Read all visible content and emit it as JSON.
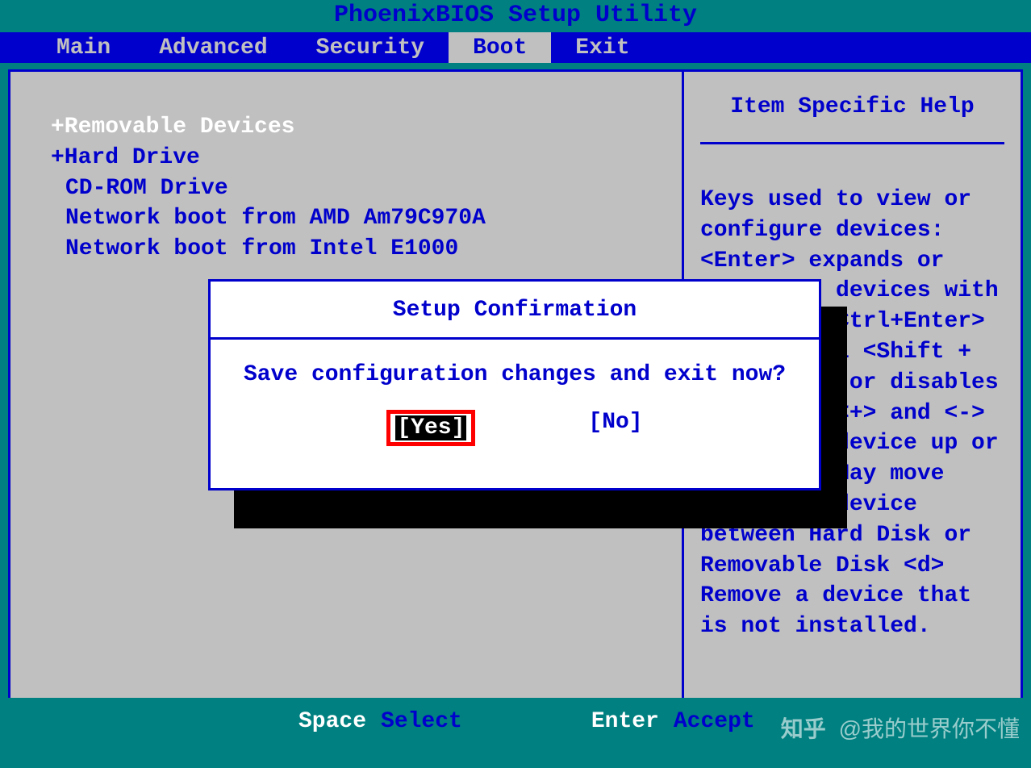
{
  "title": "PhoenixBIOS Setup Utility",
  "menu": {
    "items": [
      "Main",
      "Advanced",
      "Security",
      "Boot",
      "Exit"
    ],
    "active_index": 3
  },
  "boot": {
    "items": [
      "+Removable Devices",
      "+Hard Drive",
      "CD-ROM Drive",
      "Network boot from AMD Am79C970A",
      "Network boot from Intel E1000"
    ],
    "selected_index": 0
  },
  "help": {
    "title": "Item Specific Help",
    "text": "Keys used to view or configure devices: <Enter> expands or collapses devices with a + or - <Ctrl+Enter> expands all <Shift + 1> enables or disables a device. <+> and <-> moves the device up or down. <n> May move removable device between Hard Disk or Removable Disk <d> Remove a device that is not installed."
  },
  "dialog": {
    "title": "Setup Confirmation",
    "message": "Save configuration changes and exit now?",
    "yes": "[Yes]",
    "no": "[No]"
  },
  "footer": {
    "key1": "Space",
    "action1": "Select",
    "key2": "Enter",
    "action2": "Accept"
  },
  "watermark": {
    "logo": "知乎",
    "text": "@我的世界你不懂"
  }
}
